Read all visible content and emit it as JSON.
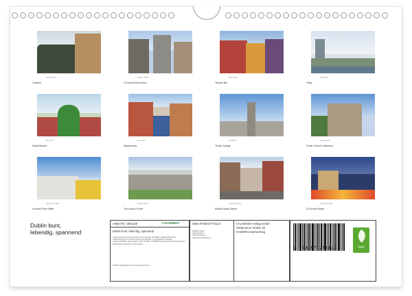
{
  "calendar": {
    "photos": [
      {
        "caption": "Tourbus",
        "month": "Januar 2024"
      },
      {
        "caption": "O'Connell Monument",
        "month": "Februar 2024"
      },
      {
        "caption": "Temple Bar",
        "month": "März 2024"
      },
      {
        "caption": "Liffey",
        "month": "April 2024"
      },
      {
        "caption": "Molly Malone",
        "month": "Mai 2024"
      },
      {
        "caption": "Sightseeing",
        "month": "Juni 2024"
      },
      {
        "caption": "Trinity College",
        "month": "Juli 2024"
      },
      {
        "caption": "Christ Church Cathedral",
        "month": "August 2024"
      },
      {
        "caption": "General Post Office",
        "month": "September 2024"
      },
      {
        "caption": "The Book of Kells",
        "month": "Oktober 2024"
      },
      {
        "caption": "Middle Abbey Street",
        "month": "November 2024"
      },
      {
        "caption": "O'Connell Street",
        "month": "Dezember 2024"
      }
    ]
  },
  "footer": {
    "title_line1": "Dublin bunt,",
    "title_line2": "lebendig, spannend",
    "article_no": "Artikel-Nr: 1991329",
    "brand": "CALVENDO",
    "subtitle": "Dublin bunt, lebendig, spannend",
    "description": "Artige bestehender Schutzrechte ist es untersagt, die Bilder, Inhalte/Daten/Texte, Verwendungen ohne Genehmigung des Verlages zu gewerblichen Zwecken weiterzuverbreiten. Alle Angaben ohne Gewähr. CALVENDO produziert Kalenderprodukte in Deutschland. Kalender © Ihre Autoren.",
    "email": "E-Mail: info@calvendo.de | www.calvendo.com",
    "isbn": "ISBN 9783457774113",
    "author_block": "Stephan Käufer\nNeuleiterweg 6\n24437 Schleswig\nwww.stephankaeufer.de",
    "publisher": "CALVENDO Verlag GmbH",
    "publisher_street": "Ottobrunner Straße 39",
    "publisher_city": "D-82008 Unterhaching",
    "barcode_digits": "9 783457 774113",
    "eco_label": "eco"
  },
  "colors": {
    "eco": "#5aa832",
    "border": "#444444"
  }
}
